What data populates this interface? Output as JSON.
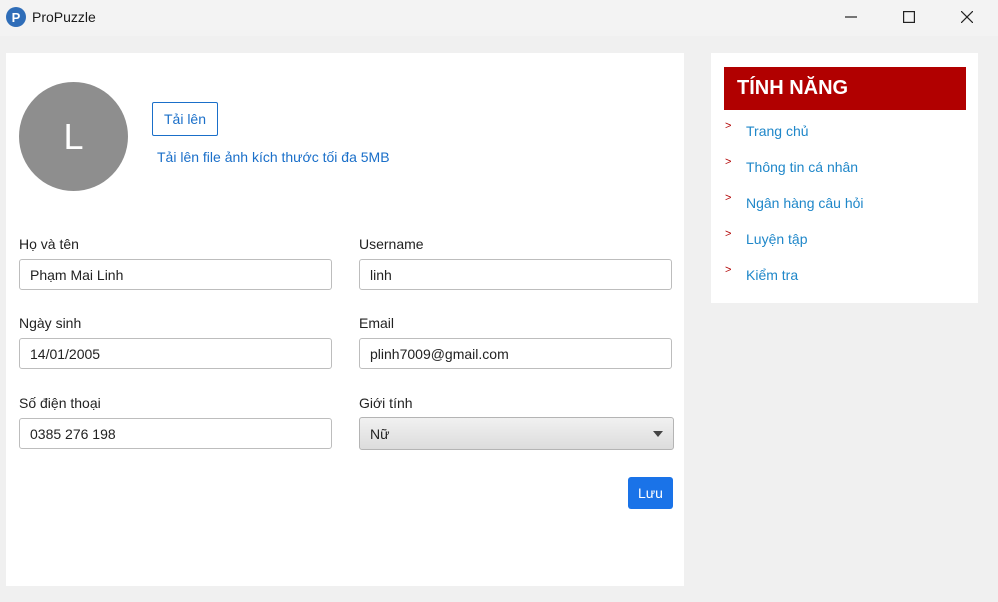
{
  "window": {
    "title": "ProPuzzle",
    "icon_letter": "P",
    "controls": [
      "minimize-icon",
      "maximize-icon",
      "close-icon"
    ]
  },
  "profile": {
    "avatar_initial": "L",
    "upload_button": "Tải lên",
    "upload_hint": "Tải lên file ảnh kích thước tối đa 5MB"
  },
  "form": {
    "fullname": {
      "label": "Họ và tên",
      "value": "Phạm Mai Linh"
    },
    "username": {
      "label": "Username",
      "value": "linh"
    },
    "dob": {
      "label": "Ngày sinh",
      "value": "14/01/2005"
    },
    "email": {
      "label": "Email",
      "value": "plinh7009@gmail.com"
    },
    "phone": {
      "label": "Số điện thoại",
      "value": "0385 276 198"
    },
    "gender": {
      "label": "Giới tính",
      "selected": "Nữ"
    },
    "save_button": "Lưu"
  },
  "sidebar": {
    "header": "TÍNH NĂNG",
    "arrow": ">",
    "items": [
      {
        "label": "Trang chủ"
      },
      {
        "label": "Thông tin cá nhân"
      },
      {
        "label": "Ngân hàng câu hỏi"
      },
      {
        "label": "Luyện tập"
      },
      {
        "label": "Kiểm tra"
      }
    ]
  },
  "colors": {
    "accent": "#1a73e8",
    "link": "#1f87c9",
    "sidebar_header": "#b10000",
    "avatar_bg": "#8e8e8e"
  }
}
